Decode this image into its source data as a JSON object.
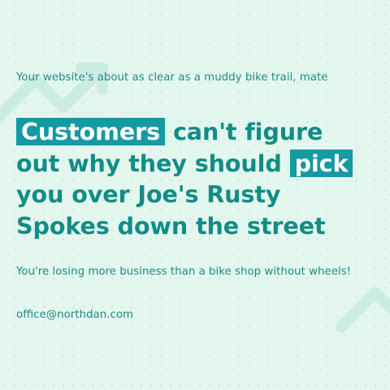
{
  "post": {
    "subheadline": "Your website's about as clear as a muddy bike trail, mate",
    "headline": {
      "highlight_1": "Customers",
      "text_1": " can't figure out why they should ",
      "highlight_2": "pick",
      "text_2": " you over Joe's Rusty Spokes down the street"
    },
    "tagline": "You're losing more business than a bike shop without wheels!",
    "contact_email": "office@northdan.com"
  },
  "colors": {
    "background": "#e3f7ee",
    "text": "#1f8a84",
    "headline": "#138c86",
    "highlight_bg": "#1599a3",
    "highlight_text": "#ffffff",
    "decoration": "#cbece0"
  },
  "icons": [
    "arrow-chevron-icon",
    "chevron-icon"
  ]
}
